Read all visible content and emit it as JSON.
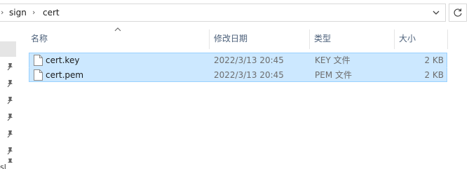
{
  "breadcrumb": {
    "items": [
      "sign",
      "cert"
    ]
  },
  "columns": {
    "name": "名称",
    "date": "修改日期",
    "type": "类型",
    "size": "大小"
  },
  "files": [
    {
      "name": "cert.key",
      "date": "2022/3/13 20:45",
      "type": "KEY 文件",
      "size": "2 KB"
    },
    {
      "name": "cert.pem",
      "date": "2022/3/13 20:45",
      "type": "PEM 文件",
      "size": "2 KB"
    }
  ],
  "nav": {
    "fragment": "sl"
  },
  "icons": {
    "address_dropdown": "chevron-down-icon",
    "refresh": "refresh-icon",
    "pin": "pin-icon",
    "file": "file-icon",
    "sort": "sort-ascending-icon"
  },
  "colors": {
    "selection_bg": "#cce8ff",
    "selection_border": "#99d1ff",
    "header_text": "#4c607a"
  }
}
